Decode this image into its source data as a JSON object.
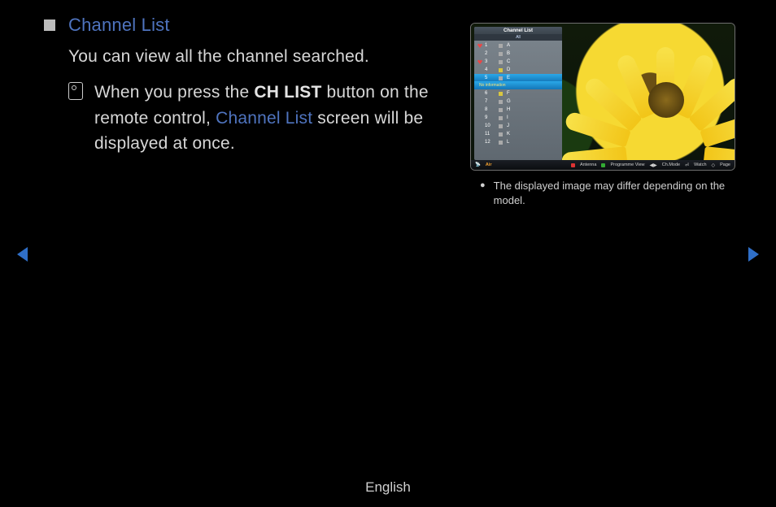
{
  "title": "Channel List",
  "description": "You can view all the channel searched.",
  "tip": {
    "prefix": "When you press the ",
    "bold": "CH LIST",
    "mid": " button on the remote control, ",
    "highlight": "Channel List",
    "suffix": " screen will be displayed at once."
  },
  "tv": {
    "panel_title": "Channel List",
    "panel_subtitle": "All",
    "selected_index": 4,
    "info_text": "No information",
    "channels": [
      {
        "num": "1",
        "name": "A",
        "fav": true,
        "dtv": false
      },
      {
        "num": "2",
        "name": "B",
        "fav": false,
        "dtv": false
      },
      {
        "num": "3",
        "name": "C",
        "fav": true,
        "dtv": false
      },
      {
        "num": "4",
        "name": "D",
        "fav": false,
        "dtv": true
      },
      {
        "num": "5",
        "name": "E",
        "fav": false,
        "dtv": false
      },
      {
        "num": "6",
        "name": "F",
        "fav": false,
        "dtv": true
      },
      {
        "num": "7",
        "name": "G",
        "fav": false,
        "dtv": false
      },
      {
        "num": "8",
        "name": "H",
        "fav": false,
        "dtv": false
      },
      {
        "num": "9",
        "name": "I",
        "fav": false,
        "dtv": false
      },
      {
        "num": "10",
        "name": "J",
        "fav": false,
        "dtv": false
      },
      {
        "num": "11",
        "name": "K",
        "fav": false,
        "dtv": false
      },
      {
        "num": "12",
        "name": "L",
        "fav": false,
        "dtv": false
      }
    ],
    "bottombar": {
      "source_icon": "antenna-icon",
      "source": "Air",
      "antenna": "Antenna",
      "progview": "Programme View",
      "chmode": "Ch.Mode",
      "watch": "Watch",
      "page": "Page"
    }
  },
  "caption": "The displayed image may differ depending on the model.",
  "footer_language": "English"
}
